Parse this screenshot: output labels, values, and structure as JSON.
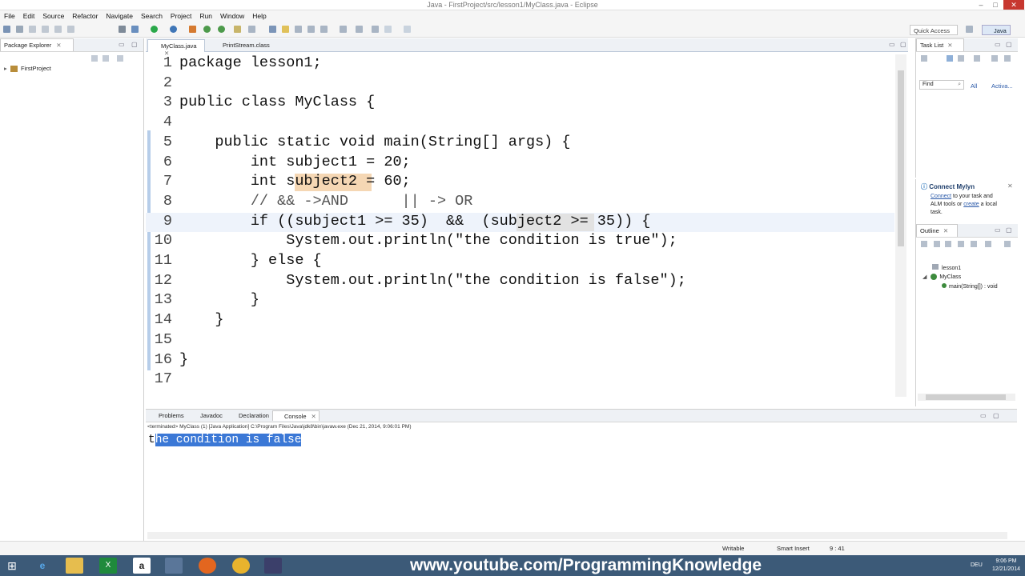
{
  "window": {
    "title": "Java - FirstProject/src/lesson1/MyClass.java - Eclipse"
  },
  "menu": [
    "File",
    "Edit",
    "Source",
    "Refactor",
    "Navigate",
    "Search",
    "Project",
    "Run",
    "Window",
    "Help"
  ],
  "toolbar": {
    "quick_access": "Quick Access",
    "perspective": "Java"
  },
  "package_explorer": {
    "tab": "Package Explorer",
    "project": "FirstProject"
  },
  "editor": {
    "tabs": [
      "MyClass.java",
      "PrintStream.class"
    ],
    "lines": [
      {
        "n": "1",
        "text": "package lesson1;"
      },
      {
        "n": "2",
        "text": ""
      },
      {
        "n": "3",
        "text": "public class MyClass {"
      },
      {
        "n": "4",
        "text": ""
      },
      {
        "n": "5",
        "text": "    public static void main(String[] args) {"
      },
      {
        "n": "6",
        "text": "        int subject1 = 20;"
      },
      {
        "n": "7",
        "text": "        int subject2 = 60;"
      },
      {
        "n": "8",
        "text": "        // && ->AND      || -> OR"
      },
      {
        "n": "9",
        "text": "        if ((subject1 >= 35)  &&  (subject2 >= 35)) {"
      },
      {
        "n": "10",
        "text": "            System.out.println(\"the condition is true\");"
      },
      {
        "n": "11",
        "text": "        } else {"
      },
      {
        "n": "12",
        "text": "            System.out.println(\"the condition is false\");"
      },
      {
        "n": "13",
        "text": "        }"
      },
      {
        "n": "14",
        "text": "    }"
      },
      {
        "n": "15",
        "text": ""
      },
      {
        "n": "16",
        "text": "}"
      },
      {
        "n": "17",
        "text": ""
      }
    ]
  },
  "task_list": {
    "tab": "Task List",
    "find": "Find",
    "all": "All",
    "activate": "Activa..."
  },
  "mylyn": {
    "title": "Connect Mylyn",
    "connect": "Connect",
    "text1": " to your task and",
    "text2": "ALM tools or ",
    "create": "create",
    "text3": " a local",
    "text4": "task."
  },
  "outline": {
    "tab": "Outline",
    "items": [
      "lesson1",
      "MyClass",
      "main(String[]) : void"
    ]
  },
  "console": {
    "tabs": [
      "Problems",
      "Javadoc",
      "Declaration",
      "Console"
    ],
    "terminated": "<terminated> MyClass (1) [Java Application] C:\\Program Files\\Java\\jdk8\\bin\\javaw.exe (Dec 21, 2014, 9:06:01 PM)",
    "output_first": "t",
    "output_rest": "he condition is false"
  },
  "status": {
    "writable": "Writable",
    "insert": "Smart Insert",
    "position": "9 : 41"
  },
  "taskbar": {
    "watermark": "www.youtube.com/ProgrammingKnowledge",
    "lang": "DEU",
    "time": "9:06 PM",
    "date": "12/21/2014"
  },
  "colors": {
    "selection": "#3b78d6",
    "highlight": "#f5d7b4",
    "taskbar": "#3c5a78"
  }
}
